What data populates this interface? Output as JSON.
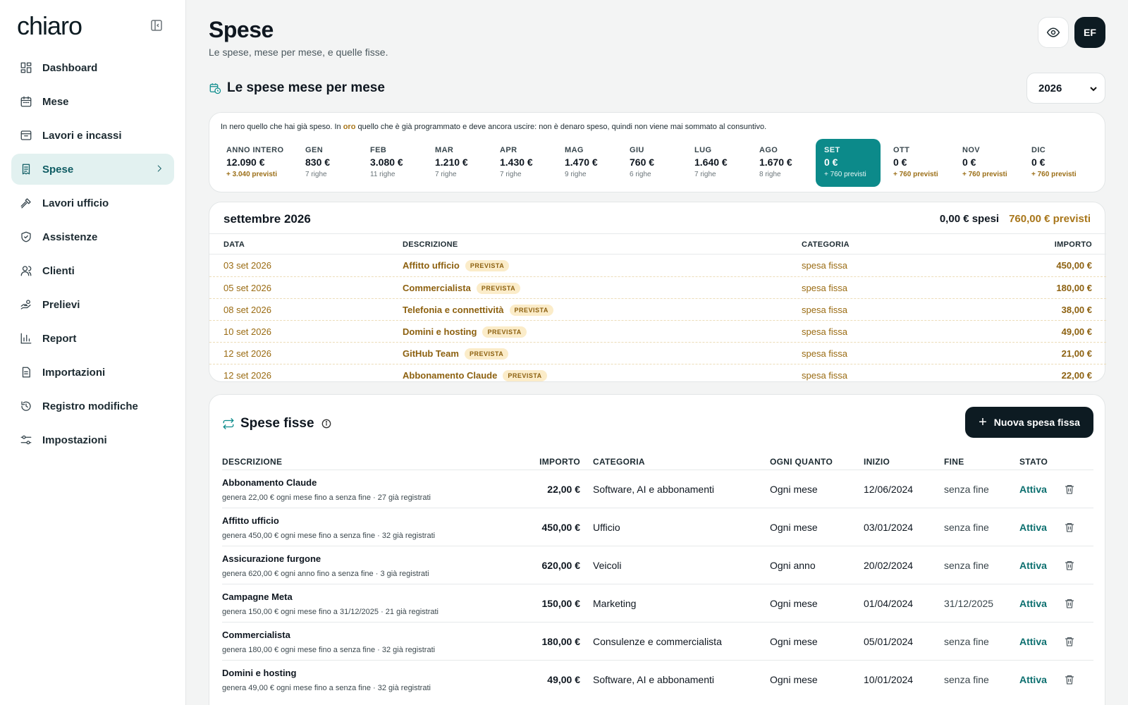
{
  "app": {
    "logo": "chiaro"
  },
  "sidebar": {
    "items": [
      {
        "label": "Dashboard",
        "icon": "dashboard-icon"
      },
      {
        "label": "Mese",
        "icon": "calendar-icon"
      },
      {
        "label": "Lavori e incassi",
        "icon": "inbox-icon"
      },
      {
        "label": "Spese",
        "icon": "receipt-icon",
        "active": true
      },
      {
        "label": "Lavori ufficio",
        "icon": "hammer-icon"
      },
      {
        "label": "Assistenze",
        "icon": "shield-icon"
      },
      {
        "label": "Clienti",
        "icon": "users-icon"
      },
      {
        "label": "Prelievi",
        "icon": "hand-coins-icon"
      },
      {
        "label": "Report",
        "icon": "bar-chart-icon"
      },
      {
        "label": "Importazioni",
        "icon": "file-icon"
      },
      {
        "label": "Registro modifiche",
        "icon": "history-icon"
      },
      {
        "label": "Impostazioni",
        "icon": "sliders-icon"
      }
    ]
  },
  "header": {
    "title": "Spese",
    "subtitle": "Le spese, mese per mese, e quelle fisse.",
    "avatar": "EF"
  },
  "monthly": {
    "title": "Le spese mese per mese",
    "year": "2026",
    "note_pre": "In nero quello che hai già speso. In ",
    "note_gold": "oro",
    "note_post": " quello che è già programmato e deve ancora uscire: non è denaro speso, quindi non viene mai sommato al consuntivo.",
    "months": [
      {
        "label": "ANNO INTERO",
        "value": "12.090 €",
        "sub": "+ 3.040 previsti",
        "gold": true
      },
      {
        "label": "GEN",
        "value": "830 €",
        "sub": "7 righe"
      },
      {
        "label": "FEB",
        "value": "3.080 €",
        "sub": "11 righe"
      },
      {
        "label": "MAR",
        "value": "1.210 €",
        "sub": "7 righe"
      },
      {
        "label": "APR",
        "value": "1.430 €",
        "sub": "7 righe"
      },
      {
        "label": "MAG",
        "value": "1.470 €",
        "sub": "9 righe"
      },
      {
        "label": "GIU",
        "value": "760 €",
        "sub": "6 righe"
      },
      {
        "label": "LUG",
        "value": "1.640 €",
        "sub": "7 righe"
      },
      {
        "label": "AGO",
        "value": "1.670 €",
        "sub": "8 righe"
      },
      {
        "label": "SET",
        "value": "0 €",
        "sub": "+ 760 previsti",
        "gold": true,
        "active": true
      },
      {
        "label": "OTT",
        "value": "0 €",
        "sub": "+ 760 previsti",
        "gold": true
      },
      {
        "label": "NOV",
        "value": "0 €",
        "sub": "+ 760 previsti",
        "gold": true
      },
      {
        "label": "DIC",
        "value": "0 €",
        "sub": "+ 760 previsti",
        "gold": true
      }
    ]
  },
  "detail": {
    "title": "settembre 2026",
    "spent": "0,00 € spesi",
    "forecast": "760,00 € previsti",
    "columns": [
      "DATA",
      "DESCRIZIONE",
      "CATEGORIA",
      "IMPORTO"
    ],
    "rows": [
      {
        "date": "03 set 2026",
        "desc": "Affitto ufficio",
        "tag": "PREVISTA",
        "cat": "spesa fissa",
        "amount": "450,00 €"
      },
      {
        "date": "05 set 2026",
        "desc": "Commercialista",
        "tag": "PREVISTA",
        "cat": "spesa fissa",
        "amount": "180,00 €"
      },
      {
        "date": "08 set 2026",
        "desc": "Telefonia e connettività",
        "tag": "PREVISTA",
        "cat": "spesa fissa",
        "amount": "38,00 €"
      },
      {
        "date": "10 set 2026",
        "desc": "Domini e hosting",
        "tag": "PREVISTA",
        "cat": "spesa fissa",
        "amount": "49,00 €"
      },
      {
        "date": "12 set 2026",
        "desc": "GitHub Team",
        "tag": "PREVISTA",
        "cat": "spesa fissa",
        "amount": "21,00 €"
      },
      {
        "date": "12 set 2026",
        "desc": "Abbonamento Claude",
        "tag": "PREVISTA",
        "cat": "spesa fissa",
        "amount": "22,00 €"
      }
    ]
  },
  "fixed": {
    "title": "Spese fisse",
    "new_button": "Nuova spesa fissa",
    "columns": [
      "DESCRIZIONE",
      "IMPORTO",
      "CATEGORIA",
      "OGNI QUANTO",
      "INIZIO",
      "FINE",
      "STATO"
    ],
    "rows": [
      {
        "desc": "Abbonamento Claude",
        "note": "genera 22,00 € ogni mese fino a senza fine · 27 già registrati",
        "amount": "22,00 €",
        "cat": "Software, AI e abbonamenti",
        "freq": "Ogni mese",
        "start": "12/06/2024",
        "end": "senza fine",
        "status": "Attiva"
      },
      {
        "desc": "Affitto ufficio",
        "note": "genera 450,00 € ogni mese fino a senza fine · 32 già registrati",
        "amount": "450,00 €",
        "cat": "Ufficio",
        "freq": "Ogni mese",
        "start": "03/01/2024",
        "end": "senza fine",
        "status": "Attiva"
      },
      {
        "desc": "Assicurazione furgone",
        "note": "genera 620,00 € ogni anno fino a senza fine · 3 già registrati",
        "amount": "620,00 €",
        "cat": "Veicoli",
        "freq": "Ogni anno",
        "start": "20/02/2024",
        "end": "senza fine",
        "status": "Attiva"
      },
      {
        "desc": "Campagne Meta",
        "note": "genera 150,00 € ogni mese fino a 31/12/2025 · 21 già registrati",
        "amount": "150,00 €",
        "cat": "Marketing",
        "freq": "Ogni mese",
        "start": "01/04/2024",
        "end": "31/12/2025",
        "status": "Attiva"
      },
      {
        "desc": "Commercialista",
        "note": "genera 180,00 € ogni mese fino a senza fine · 32 già registrati",
        "amount": "180,00 €",
        "cat": "Consulenze e commercialista",
        "freq": "Ogni mese",
        "start": "05/01/2024",
        "end": "senza fine",
        "status": "Attiva"
      },
      {
        "desc": "Domini e hosting",
        "note": "genera 49,00 € ogni mese fino a senza fine · 32 già registrati",
        "amount": "49,00 €",
        "cat": "Software, AI e abbonamenti",
        "freq": "Ogni mese",
        "start": "10/01/2024",
        "end": "senza fine",
        "status": "Attiva"
      }
    ]
  }
}
